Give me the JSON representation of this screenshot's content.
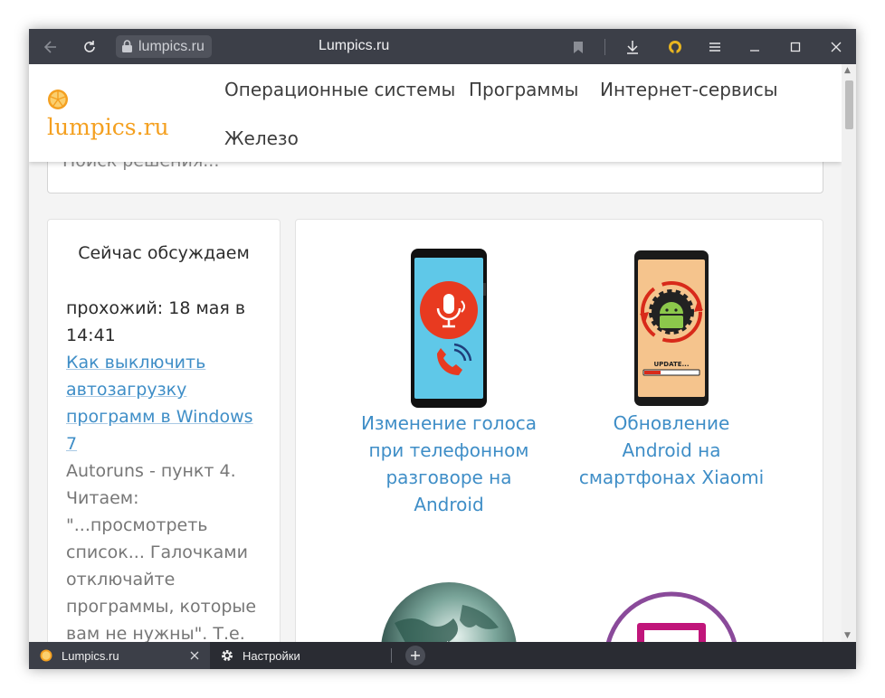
{
  "browser": {
    "address_text": "lumpics.ru",
    "page_title": "Lumpics.ru",
    "icons": [
      "back-arrow-icon",
      "reload-icon",
      "lock-icon",
      "bookmark-icon",
      "download-icon",
      "protect-icon",
      "menu-icon",
      "minimize-icon",
      "maximize-icon",
      "close-icon"
    ]
  },
  "site": {
    "logo_text": "lumpics.ru",
    "nav": [
      "Операционные системы",
      "Программы",
      "Интернет-сервисы",
      "Железо"
    ],
    "search_placeholder": "Поиск решения..."
  },
  "sidebar": {
    "title": "Сейчас обсуждаем",
    "comment": {
      "meta": "прохожий: 18 мая в 14:41",
      "link": "Как выключить автозагрузку программ в Windows 7",
      "text": "Autoruns - пункт 4. Читаем: \"...просмотреть список... Галочками отключайте программы, которые вам не нужны\". Т.е."
    }
  },
  "articles": [
    {
      "title": "Изменение голоса при телефонном разговоре на Android",
      "image": "phone-voice-changer-image"
    },
    {
      "title": "Обновление Android на смартфонах Xiaomi",
      "image": "phone-android-update-image"
    },
    {
      "title": "",
      "image": "globe-image"
    },
    {
      "title": "",
      "image": "purple-circle-image"
    }
  ],
  "phone_update_label": "UPDATE...",
  "tabs": [
    {
      "label": "Lumpics.ru",
      "active": true
    },
    {
      "label": "Настройки",
      "active": false
    }
  ],
  "colors": {
    "titlebar": "#3c3f48",
    "link": "#3f8ec7",
    "logo": "#f4a020",
    "tabbar": "#2a2c33"
  }
}
